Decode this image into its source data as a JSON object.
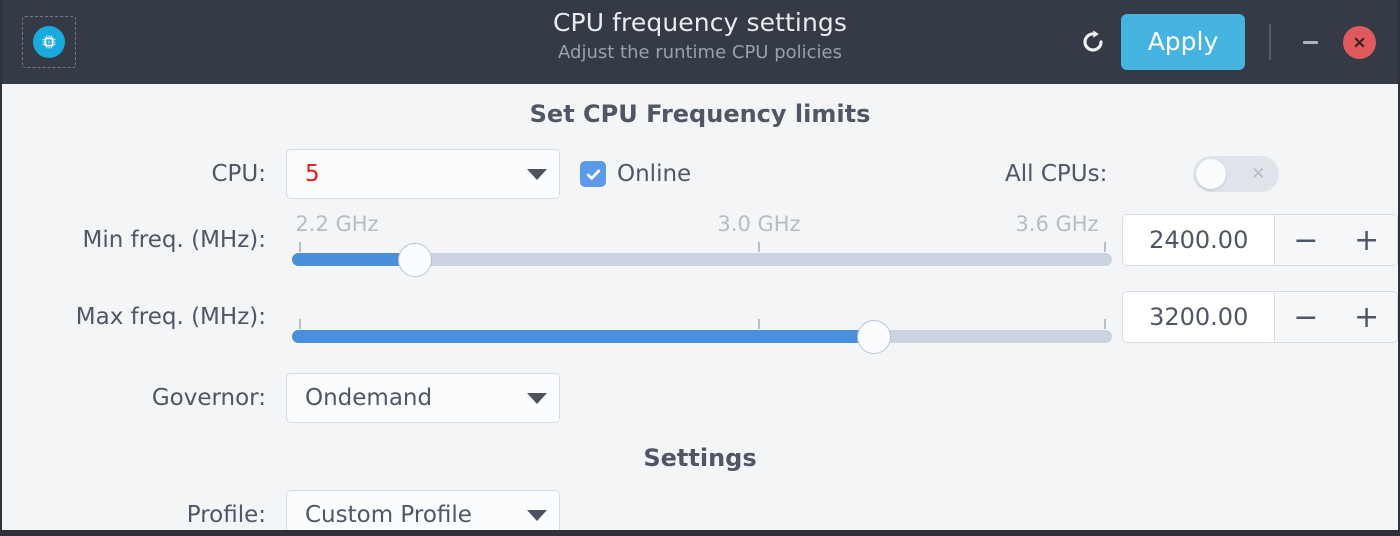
{
  "titlebar": {
    "app_icon": "cpu-chip-icon",
    "title": "CPU frequency settings",
    "subtitle": "Adjust the runtime CPU policies",
    "refresh_icon": "refresh-icon",
    "apply_label": "Apply",
    "minimize_icon": "minimize-icon",
    "close_icon": "close-icon",
    "accent_color": "#45b4e0",
    "close_color": "#e05a5d",
    "background_color": "#343a46"
  },
  "main": {
    "heading": "Set CPU Frequency limits",
    "settings_heading": "Settings",
    "cpu": {
      "label": "CPU:",
      "value": "5",
      "value_color": "#e81b16",
      "caret_icon": "chevron-down-icon",
      "online_label": "Online",
      "online_checked": true,
      "check_icon": "check-icon"
    },
    "all_cpus": {
      "label": "All CPUs:",
      "enabled": false,
      "off_icon": "x-icon"
    },
    "min_freq": {
      "label": "Min freq. (MHz):",
      "value": "2400.00",
      "minus_label": "−",
      "plus_label": "+"
    },
    "max_freq": {
      "label": "Max freq. (MHz):",
      "value": "3200.00",
      "minus_label": "−",
      "plus_label": "+"
    },
    "slider_scale": {
      "ticks": [
        "2.2 GHz",
        "3.0 GHz",
        "3.6 GHz"
      ],
      "tick_positions_pct": [
        0,
        57,
        99
      ],
      "min_handle_pct": 15,
      "max_handle_pct": 71,
      "fill_color": "#4a8fdb",
      "track_color": "#ccd3e0"
    },
    "governor": {
      "label": "Governor:",
      "value": "Ondemand",
      "caret_icon": "chevron-down-icon"
    },
    "profile": {
      "label": "Profile:",
      "value": "Custom Profile",
      "caret_icon": "chevron-down-icon"
    }
  }
}
